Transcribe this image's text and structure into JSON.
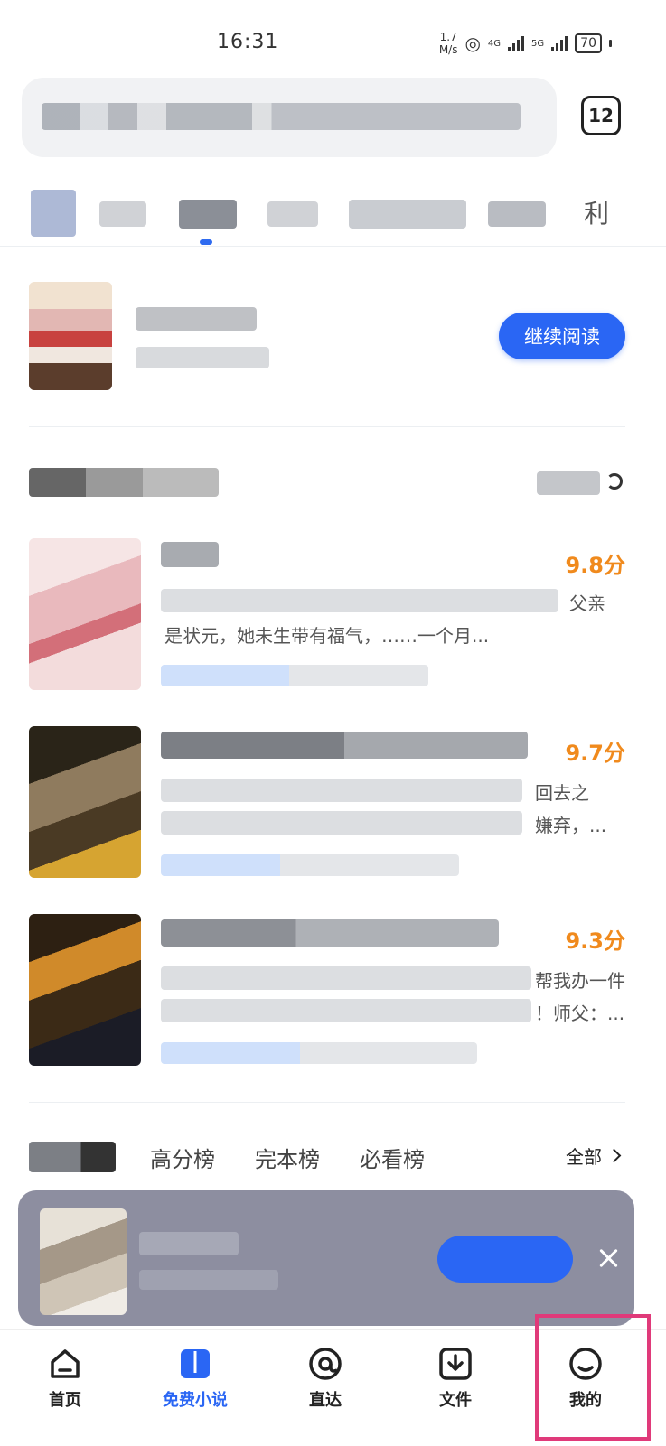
{
  "status_bar": {
    "time": "16:31",
    "net_speed": "1.7",
    "net_unit": "M/s",
    "net_4g": "4G",
    "net_5g": "5G",
    "battery": "70"
  },
  "search": {
    "tab_count": "12"
  },
  "categories": {
    "last_visible": "利"
  },
  "continue_reading": {
    "button": "继续阅读"
  },
  "books": [
    {
      "score": "9.8分",
      "desc_line1": "父亲",
      "desc_line2": "是状元，她未生带有福气，……一个月..."
    },
    {
      "score": "9.7分",
      "desc_line1": "回去之",
      "desc_line2": "嫌弃，..."
    },
    {
      "score": "9.3分",
      "desc_line1": "帮我办一件",
      "desc_line2": "！师父：..."
    }
  ],
  "rank_tabs": [
    "高分榜",
    "完本榜",
    "必看榜"
  ],
  "rank_all": "全部",
  "bottom_nav": [
    {
      "label": "首页",
      "icon": "home-icon"
    },
    {
      "label": "免费小说",
      "icon": "book-icon"
    },
    {
      "label": "直达",
      "icon": "at-icon"
    },
    {
      "label": "文件",
      "icon": "download-icon"
    },
    {
      "label": "我的",
      "icon": "profile-icon"
    }
  ],
  "colors": {
    "accent": "#2a66f4",
    "score": "#f08a1d",
    "highlight": "#e03a7a"
  }
}
